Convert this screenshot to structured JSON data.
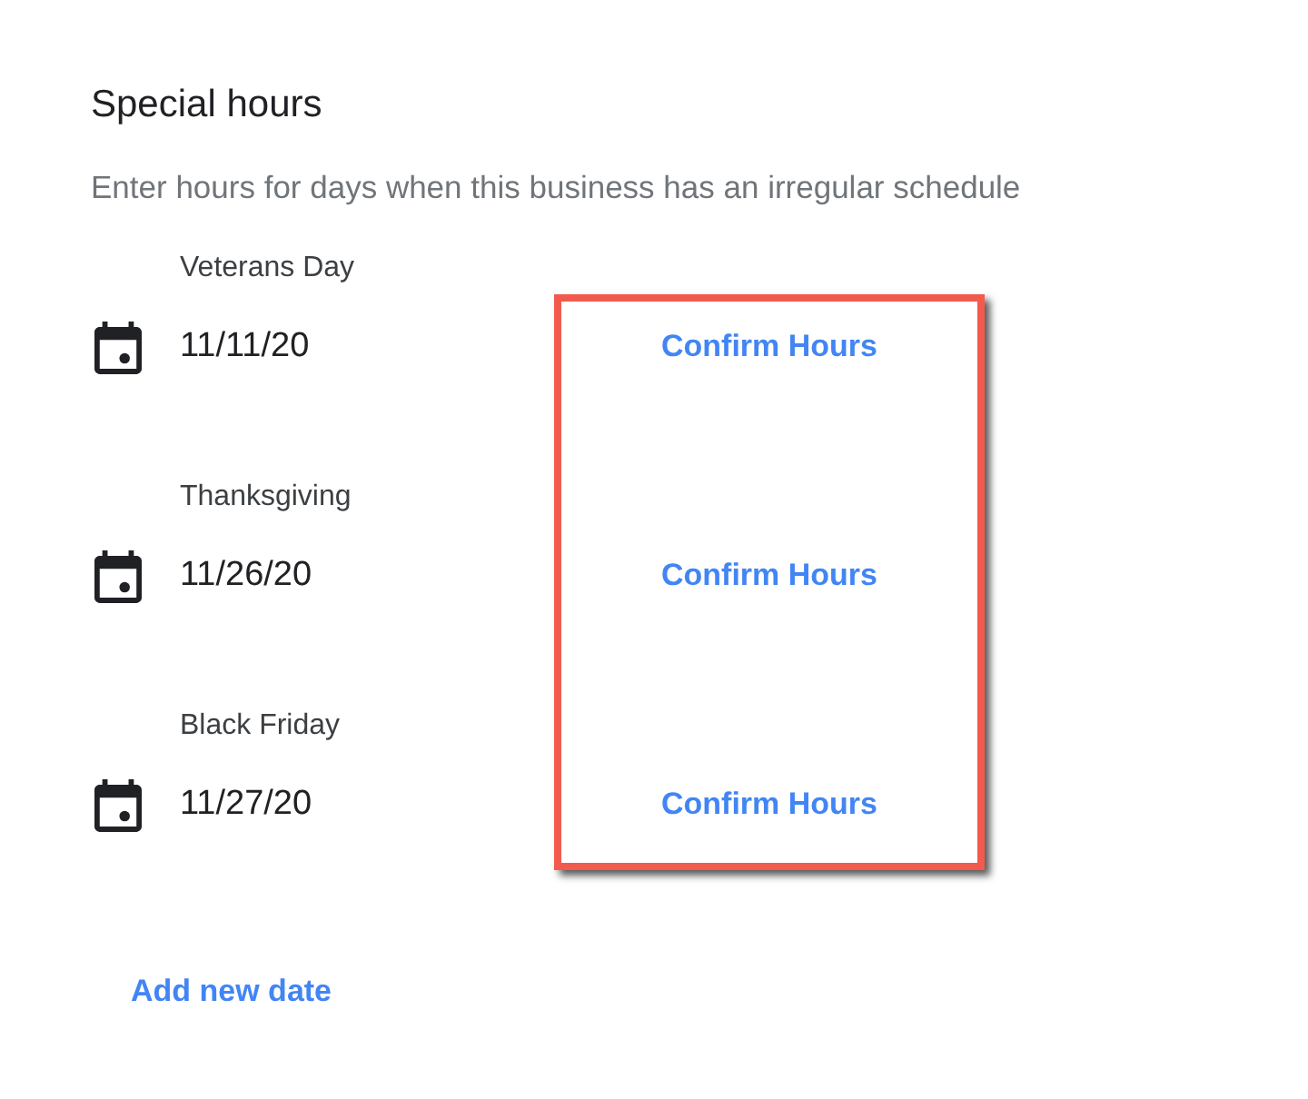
{
  "section": {
    "title": "Special hours",
    "description": "Enter hours for days when this business has an irregular schedule"
  },
  "dates": [
    {
      "name": "Veterans Day",
      "date": "11/11/20",
      "action": "Confirm Hours"
    },
    {
      "name": "Thanksgiving",
      "date": "11/26/20",
      "action": "Confirm Hours"
    },
    {
      "name": "Black Friday",
      "date": "11/27/20",
      "action": "Confirm Hours"
    }
  ],
  "add_button": "Add new date"
}
